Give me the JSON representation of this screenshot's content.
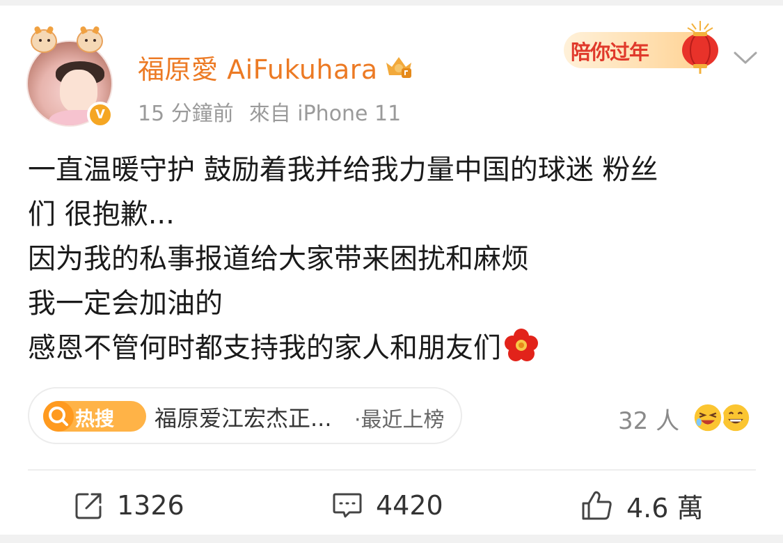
{
  "post": {
    "author": {
      "name": "福原愛 AiFukuhara",
      "verified_badge": "V",
      "avatar_icon": "avatar-photo-with-cow-frame"
    },
    "meta": {
      "time": "15 分鐘前",
      "source": "來自 iPhone 11"
    },
    "festival_badge": {
      "label": "陪你过年",
      "icon": "red-lantern-icon"
    },
    "body_lines": [
      "一直温暖守护 鼓励着我并给我力量中国的球迷 粉丝",
      "们 很抱歉...",
      "因为我的私事报道给大家带来困扰和麻烦",
      "我一定会加油的",
      "感恩不管何时都支持我的家人和朋友们"
    ],
    "hot_search": {
      "icon_label": "热搜",
      "title": "福原爱江宏杰正...",
      "tag": "·最近上榜"
    },
    "reactions": {
      "count_label": "32 人",
      "emojis": [
        "laughing-crying-emoji",
        "grinning-emoji"
      ]
    },
    "actions": {
      "repost_count": "1326",
      "comment_count": "4420",
      "like_count": "4.6 萬"
    }
  },
  "colors": {
    "accent_name": "#ec7a24",
    "meta_gray": "#9a9a9a",
    "text": "#1a1a1a",
    "festival_red": "#e0392b",
    "hot_orange": "#ff9a1f"
  }
}
